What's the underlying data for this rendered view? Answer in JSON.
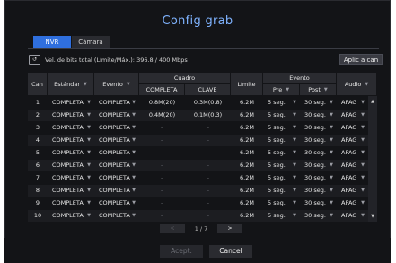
{
  "dialog": {
    "title": "Config grab",
    "tabs": [
      {
        "label": "NVR",
        "active": true
      },
      {
        "label": "Cámara",
        "active": false
      }
    ],
    "bitrate_text": "Vel. de bits total (Límite/Máx.): 396.8 / 400 Mbps",
    "apply_all_label": "Aplic a can",
    "headers": {
      "can": "Can",
      "estandar": "Estándar",
      "evento": "Evento",
      "cuadro": "Cuadro",
      "completa": "COMPLETA",
      "clave": "CLAVE",
      "limite": "Límite",
      "evento_group": "Evento",
      "pre": "Pre",
      "post": "Post",
      "audio": "Audio"
    },
    "rows": [
      {
        "can": "1",
        "estandar": "COMPLETA",
        "evento": "COMPLETA",
        "completa": "0.8M(20)",
        "clave": "0.3M(0.8)",
        "limite": "6.2M",
        "pre": "5 seg.",
        "post": "30 seg.",
        "audio": "APAG"
      },
      {
        "can": "2",
        "estandar": "COMPLETA",
        "evento": "COMPLETA",
        "completa": "0.4M(20)",
        "clave": "0.1M(0.3)",
        "limite": "6.2M",
        "pre": "5 seg.",
        "post": "30 seg.",
        "audio": "APAG"
      },
      {
        "can": "3",
        "estandar": "COMPLETA",
        "evento": "COMPLETA",
        "completa": "–",
        "clave": "–",
        "limite": "6.2M",
        "pre": "5 seg.",
        "post": "30 seg.",
        "audio": "APAG"
      },
      {
        "can": "4",
        "estandar": "COMPLETA",
        "evento": "COMPLETA",
        "completa": "–",
        "clave": "–",
        "limite": "6.2M",
        "pre": "5 seg.",
        "post": "30 seg.",
        "audio": "APAG"
      },
      {
        "can": "5",
        "estandar": "COMPLETA",
        "evento": "COMPLETA",
        "completa": "–",
        "clave": "–",
        "limite": "6.2M",
        "pre": "5 seg.",
        "post": "30 seg.",
        "audio": "APAG"
      },
      {
        "can": "6",
        "estandar": "COMPLETA",
        "evento": "COMPLETA",
        "completa": "–",
        "clave": "–",
        "limite": "6.2M",
        "pre": "5 seg.",
        "post": "30 seg.",
        "audio": "APAG"
      },
      {
        "can": "7",
        "estandar": "COMPLETA",
        "evento": "COMPLETA",
        "completa": "–",
        "clave": "–",
        "limite": "6.2M",
        "pre": "5 seg.",
        "post": "30 seg.",
        "audio": "APAG"
      },
      {
        "can": "8",
        "estandar": "COMPLETA",
        "evento": "COMPLETA",
        "completa": "–",
        "clave": "–",
        "limite": "6.2M",
        "pre": "5 seg.",
        "post": "30 seg.",
        "audio": "APAG"
      },
      {
        "can": "9",
        "estandar": "COMPLETA",
        "evento": "COMPLETA",
        "completa": "–",
        "clave": "–",
        "limite": "6.2M",
        "pre": "5 seg.",
        "post": "30 seg.",
        "audio": "APAG"
      },
      {
        "can": "10",
        "estandar": "COMPLETA",
        "evento": "COMPLETA",
        "completa": "–",
        "clave": "–",
        "limite": "6.2M",
        "pre": "5 seg.",
        "post": "30 seg.",
        "audio": "APAG"
      }
    ],
    "pager": {
      "prev": "<",
      "text": "1 / 7",
      "next": ">"
    },
    "ok_label": "Acept.",
    "cancel_label": "Cancel"
  },
  "colors": {
    "accent": "#2f6fde",
    "title": "#7fb3ff",
    "background": "#131417"
  }
}
